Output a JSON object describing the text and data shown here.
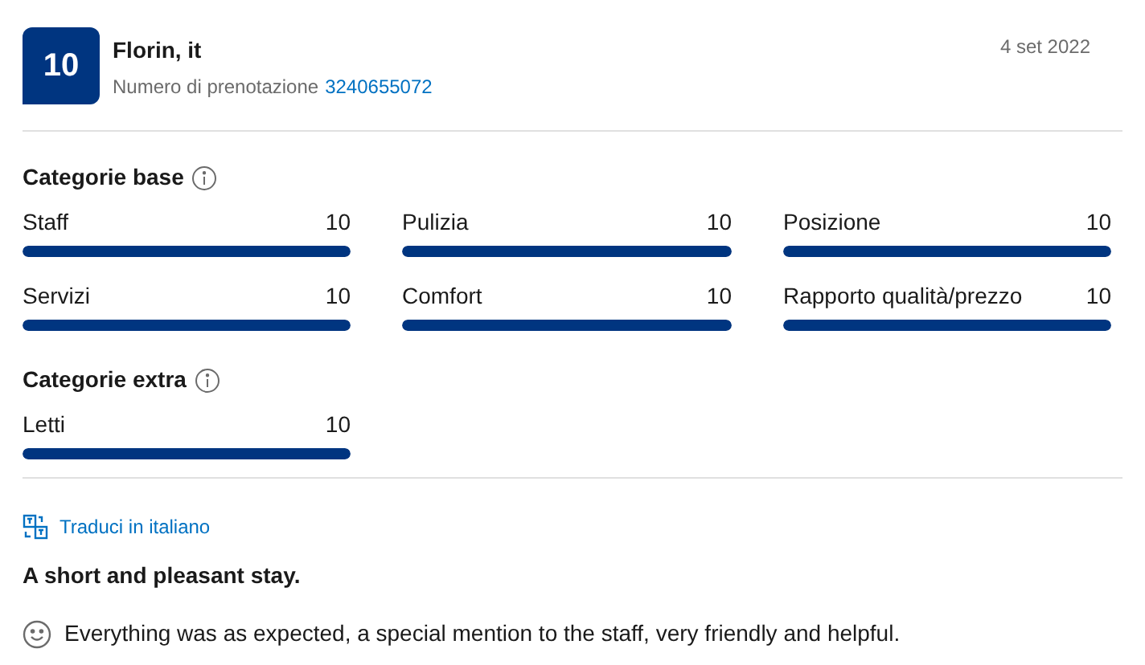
{
  "review": {
    "score": "10",
    "name": "Florin, it",
    "booking_label": "Numero di prenotazione",
    "booking_number": "3240655072",
    "date": "4 set 2022"
  },
  "sections": [
    {
      "title": "Categorie base",
      "categories": [
        {
          "name": "Staff",
          "score": "10",
          "level": 1
        },
        {
          "name": "Pulizia",
          "score": "10",
          "level": 1
        },
        {
          "name": "Posizione",
          "score": "10",
          "level": 1
        },
        {
          "name": "Servizi",
          "score": "10",
          "level": 1
        },
        {
          "name": "Comfort",
          "score": "10",
          "level": 1
        },
        {
          "name": "Rapporto qualità/prezzo",
          "score": "10",
          "level": 1
        }
      ]
    },
    {
      "title": "Categorie extra",
      "categories": [
        {
          "name": "Letti",
          "score": "10",
          "level": 1
        }
      ]
    }
  ],
  "translate_link": "Traduci in italiano",
  "review_title": "A short and pleasant stay.",
  "review_text": "Everything was as expected, a special mention to the staff, very friendly and helpful."
}
